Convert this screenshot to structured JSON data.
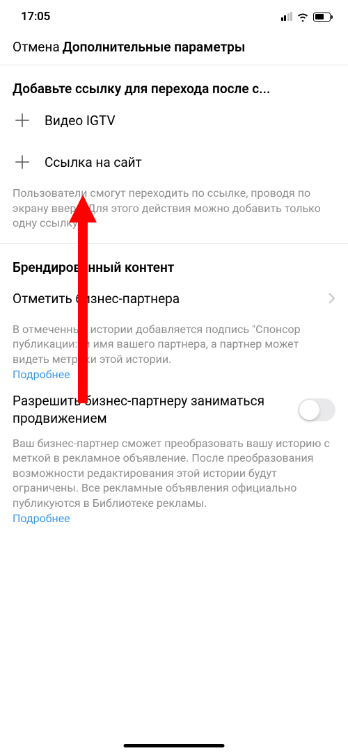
{
  "status": {
    "time": "17:05"
  },
  "header": {
    "cancel": "Отмена",
    "title": "Дополнительные параметры"
  },
  "link_section": {
    "title": "Добавьте ссылку для перехода после с...",
    "igtv_label": "Видео IGTV",
    "weblink_label": "Ссылка на сайт",
    "description": "Пользователи смогут переходить по ссылке, проводя по экрану вверх. Для этого действия можно добавить только одну ссылку."
  },
  "branded_section": {
    "title": "Брендированный контент",
    "tag_partner": "Отметить бизнес-партнера",
    "tag_description": "В отмеченные истории добавляется подпись \"Спонсор публикации:\" и имя вашего партнера, а партнер может видеть метрики этой истории.",
    "more": "Подробнее",
    "promote_label": "Разрешить бизнес-партнеру заниматься продвижением",
    "promote_description": "Ваш бизнес-партнер сможет преобразовать вашу историю с меткой в рекламное объявление. После преобразования возможности редактирования этой истории будут ограничены. Все рекламные объявления официально публикуются в Библиотеке рекламы."
  }
}
